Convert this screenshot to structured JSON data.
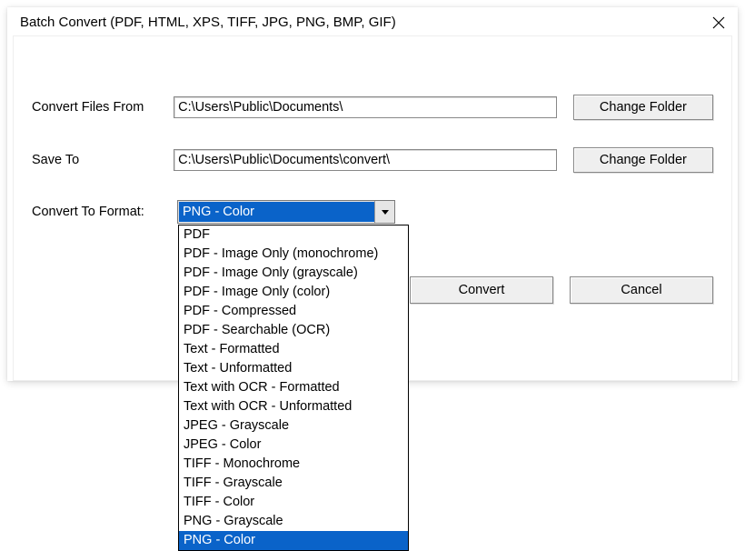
{
  "window": {
    "title": "Batch Convert (PDF, HTML, XPS, TIFF, JPG, PNG, BMP, GIF)"
  },
  "labels": {
    "convert_from": "Convert Files From",
    "save_to": "Save To",
    "format": "Convert To Format:"
  },
  "fields": {
    "convert_from_value": "C:\\Users\\Public\\Documents\\",
    "save_to_value": "C:\\Users\\Public\\Documents\\convert\\"
  },
  "buttons": {
    "change_folder": "Change Folder",
    "convert": "Convert",
    "cancel": "Cancel"
  },
  "combo": {
    "selected": "PNG - Color",
    "options": [
      "PDF",
      "PDF - Image Only (monochrome)",
      "PDF - Image Only (grayscale)",
      "PDF - Image Only (color)",
      "PDF - Compressed",
      "PDF - Searchable (OCR)",
      "Text - Formatted",
      "Text - Unformatted",
      "Text with OCR - Formatted",
      "Text with OCR - Unformatted",
      "JPEG - Grayscale",
      "JPEG - Color",
      "TIFF - Monochrome",
      "TIFF - Grayscale",
      "TIFF - Color",
      "PNG - Grayscale",
      "PNG - Color"
    ]
  }
}
